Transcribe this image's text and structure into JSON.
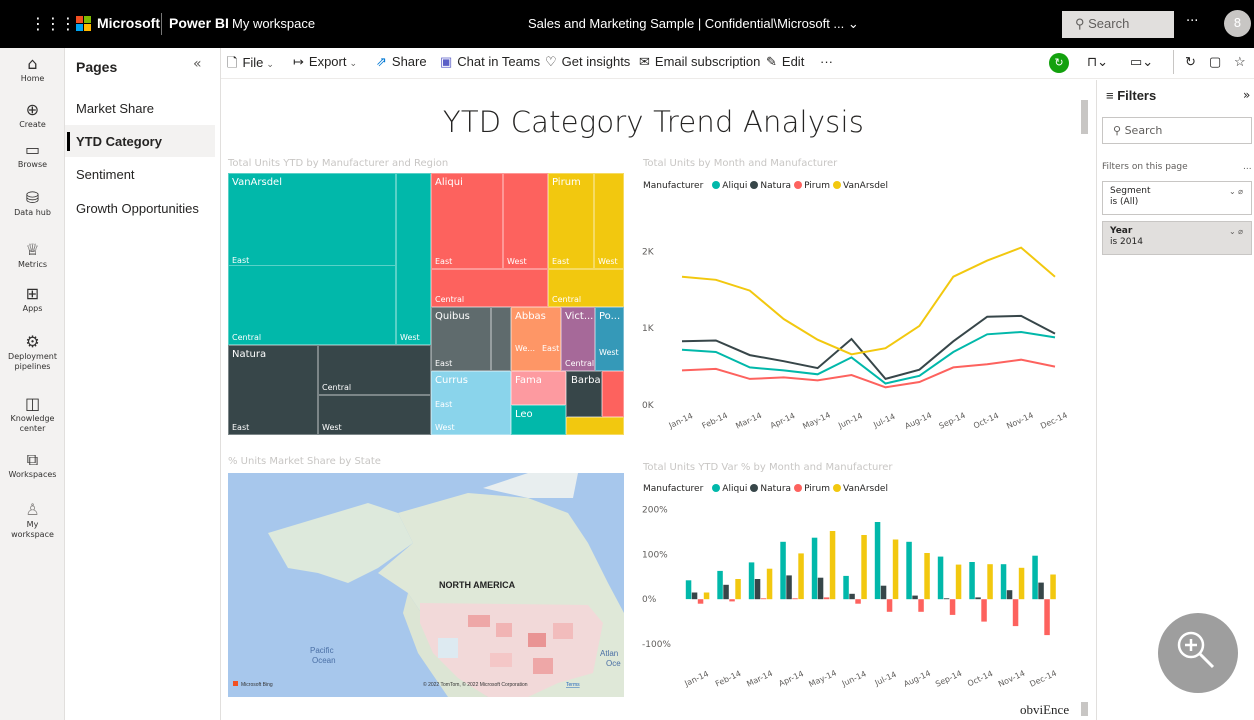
{
  "topbar": {
    "app_launcher_icon": "waffle-icon",
    "brand": "Microsoft",
    "product": "Power BI",
    "workspace": "My workspace",
    "report_title": "Sales and Marketing Sample  |  Confidential\\Microsoft ...  ⌄",
    "search_placeholder": "Search",
    "more": "···",
    "avatar": "8",
    "colors": {
      "ms_red": "#f25022",
      "ms_green": "#7fba00",
      "ms_blue": "#00a4ef",
      "ms_yellow": "#ffb900"
    }
  },
  "leftnav": {
    "items": [
      {
        "icon": "home-icon",
        "glyph": "⌂",
        "label": "Home"
      },
      {
        "icon": "create-icon",
        "glyph": "⊕",
        "label": "Create"
      },
      {
        "icon": "browse-icon",
        "glyph": "▭",
        "label": "Browse"
      },
      {
        "icon": "data-hub-icon",
        "glyph": "⛁",
        "label": "Data hub"
      },
      {
        "icon": "metrics-icon",
        "glyph": "♕",
        "label": "Metrics"
      },
      {
        "icon": "apps-icon",
        "glyph": "⊞",
        "label": "Apps"
      },
      {
        "icon": "deployment-icon",
        "glyph": "⚙",
        "label1": "Deployment",
        "label2": "pipelines"
      },
      {
        "icon": "knowledge-icon",
        "glyph": "◫",
        "label1": "Knowledge",
        "label2": "center"
      },
      {
        "icon": "workspaces-icon",
        "glyph": "⧉",
        "label": "Workspaces"
      },
      {
        "icon": "my-workspace-icon",
        "glyph": "♙",
        "label1": "My",
        "label2": "workspace"
      }
    ]
  },
  "pages": {
    "header": "Pages",
    "collapse": "«",
    "items": [
      "Market Share",
      "YTD Category",
      "Sentiment",
      "Growth Opportunities"
    ],
    "active": "YTD Category"
  },
  "toolbar": {
    "file": "File",
    "export": "Export",
    "share": "Share",
    "chat": "Chat in Teams",
    "insights": "Get insights",
    "email": "Email subscription",
    "edit": "Edit",
    "more": "···"
  },
  "report": {
    "title": "YTD Category Trend Analysis",
    "treemap_title": "Total Units YTD by Manufacturer and Region",
    "map_title": "% Units Market Share by State",
    "map_labels": {
      "continent": "NORTH AMERICA",
      "pacific1": "Pacific",
      "pacific2": "Ocean",
      "atlantic1": "Atlan",
      "atlantic2": "Oce",
      "bing": "Microsoft Bing",
      "copyright": "© 2022 TomTom, © 2022 Microsoft Corporation",
      "terms": "Terms"
    },
    "line_title": "Total Units by Month and Manufacturer",
    "bar_title": "Total Units YTD Var % by Month and Manufacturer",
    "legend_label": "Manufacturer",
    "watermark": "obviEnce"
  },
  "treemap": {
    "cells": [
      {
        "name": "VanArsdel",
        "color": "#01b8aa",
        "labels": [
          "VanArsdel"
        ]
      },
      {
        "name": "Aliqui",
        "color": "#fd625e",
        "labels": [
          "Aliqui"
        ]
      },
      {
        "name": "Pirum",
        "color": "#f2c80f",
        "labels": [
          "Pirum"
        ]
      },
      {
        "name": "Natura",
        "color": "#374649",
        "labels": [
          "Natura"
        ]
      },
      {
        "name": "Quibus",
        "color": "#5f6b6d",
        "labels": [
          "Quibus"
        ]
      },
      {
        "name": "Abbas",
        "color": "#fe9666",
        "labels": [
          "Abbas"
        ]
      },
      {
        "name": "Victoria",
        "color": "#a66999",
        "labels": [
          "Vict..."
        ]
      },
      {
        "name": "Pomum",
        "color": "#3599b8",
        "labels": [
          "Po..."
        ]
      },
      {
        "name": "Currus",
        "color": "#8ad4eb",
        "labels": [
          "Currus"
        ]
      },
      {
        "name": "Fama",
        "color": "#fd9aa0",
        "labels": [
          "Fama"
        ]
      },
      {
        "name": "Barba",
        "color": "#374649",
        "labels": [
          "Barba"
        ]
      },
      {
        "name": "Leo",
        "color": "#01b8aa",
        "labels": [
          "Leo"
        ]
      }
    ],
    "regions": {
      "east": "East",
      "west": "West",
      "central": "Central",
      "we": "We...",
      "east_short": "East"
    }
  },
  "series_colors": {
    "Aliqui": "#01b8aa",
    "Natura": "#374649",
    "Pirum": "#fd625e",
    "VanArsdel": "#f2c80f"
  },
  "chart_data": [
    {
      "type": "line",
      "title": "Total Units by Month and Manufacturer",
      "categories": [
        "Jan-14",
        "Feb-14",
        "Mar-14",
        "Apr-14",
        "May-14",
        "Jun-14",
        "Jul-14",
        "Aug-14",
        "Sep-14",
        "Oct-14",
        "Nov-14",
        "Dec-14"
      ],
      "yticks": [
        "0K",
        "1K",
        "2K"
      ],
      "ylim": [
        0,
        2500
      ],
      "series": [
        {
          "name": "Aliqui",
          "values": [
            720,
            690,
            490,
            450,
            400,
            620,
            280,
            380,
            690,
            920,
            950,
            880
          ]
        },
        {
          "name": "Natura",
          "values": [
            830,
            840,
            650,
            570,
            480,
            860,
            340,
            460,
            830,
            1150,
            1160,
            930
          ]
        },
        {
          "name": "Pirum",
          "values": [
            450,
            470,
            340,
            360,
            320,
            390,
            230,
            300,
            490,
            530,
            590,
            500
          ]
        },
        {
          "name": "VanArsdel",
          "values": [
            1670,
            1630,
            1490,
            1120,
            850,
            660,
            740,
            1030,
            1670,
            1880,
            2050,
            1670
          ]
        }
      ]
    },
    {
      "type": "bar",
      "title": "Total Units YTD Var % by Month and Manufacturer",
      "categories": [
        "Jan-14",
        "Feb-14",
        "Mar-14",
        "Apr-14",
        "May-14",
        "Jun-14",
        "Jul-14",
        "Aug-14",
        "Sep-14",
        "Oct-14",
        "Nov-14",
        "Dec-14"
      ],
      "yticks": [
        "-100%",
        "0%",
        "100%",
        "200%"
      ],
      "ylim": [
        -120,
        210
      ],
      "series": [
        {
          "name": "Aliqui",
          "values": [
            42,
            63,
            82,
            128,
            137,
            52,
            172,
            128,
            95,
            83,
            78,
            97
          ]
        },
        {
          "name": "Natura",
          "values": [
            15,
            32,
            45,
            53,
            48,
            12,
            30,
            8,
            2,
            4,
            20,
            37
          ]
        },
        {
          "name": "Pirum",
          "values": [
            -10,
            -5,
            2,
            2,
            4,
            -10,
            -28,
            -28,
            -35,
            -50,
            -60,
            -80
          ]
        },
        {
          "name": "VanArsdel",
          "values": [
            15,
            45,
            68,
            102,
            152,
            143,
            133,
            103,
            77,
            78,
            70,
            55
          ]
        }
      ]
    }
  ],
  "filters": {
    "header": "Filters",
    "collapse": "»",
    "search_placeholder": "Search",
    "section": "Filters on this page",
    "section_more": "...",
    "cards": [
      {
        "field": "Segment",
        "value": "is (All)",
        "selected": false
      },
      {
        "field": "Year",
        "value": "is 2014",
        "selected": true
      }
    ]
  }
}
